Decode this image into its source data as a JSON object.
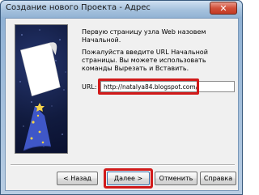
{
  "window": {
    "title": "Создание нового Проекта - Адрес",
    "close_symbol": "✕"
  },
  "content": {
    "intro_text": "Первую страницу узла Web назовем Начальной.",
    "instruction_text": "Пожалуйста введите URL Начальной страницы. Вы можете использовать команды Вырезать и Вставить.",
    "url_label": "URL:",
    "url_value": "http://natalya84.blogspot.com/"
  },
  "buttons": {
    "back": "< Назад",
    "next": "Далее >",
    "cancel": "Отменить",
    "help": "Справка"
  },
  "highlights": {
    "color": "#d11a1a"
  }
}
